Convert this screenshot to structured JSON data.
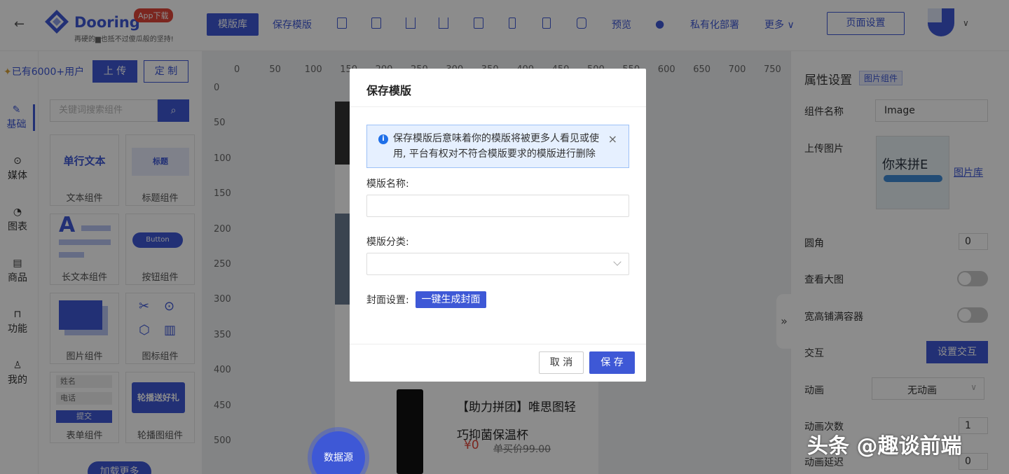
{
  "header": {
    "brand": "Dooring",
    "slogan": "再硬的▆也抵不过傻瓜般的坚持!",
    "app_badge": "App下载",
    "toolbar": {
      "template_lib": "模版库",
      "save_template": "保存模版",
      "preview": "预览",
      "private_deploy": "私有化部署",
      "more": "更多",
      "page_settings": "页面设置"
    }
  },
  "left_rail": {
    "items": [
      {
        "label": "基础",
        "icon": "brush-icon",
        "active": true
      },
      {
        "label": "媒体",
        "icon": "play-circle-icon"
      },
      {
        "label": "图表",
        "icon": "pie-chart-icon"
      },
      {
        "label": "商品",
        "icon": "shop-icon"
      },
      {
        "label": "功能",
        "icon": "function-icon"
      },
      {
        "label": "我的",
        "icon": "user-icon"
      }
    ]
  },
  "left_panel": {
    "users_text": "已有6000+用户",
    "upload": "上 传",
    "custom": "定 制",
    "search_placeholder": "关键词搜索组件",
    "components": [
      {
        "label": "文本组件",
        "preview": "单行文本"
      },
      {
        "label": "标题组件",
        "preview": "标题"
      },
      {
        "label": "长文本组件",
        "preview": "A"
      },
      {
        "label": "按钮组件",
        "preview": "Button"
      },
      {
        "label": "图片组件"
      },
      {
        "label": "图标组件"
      },
      {
        "label": "表单组件",
        "preview_name": "姓名",
        "preview_phone": "电话",
        "preview_submit": "提交"
      },
      {
        "label": "轮播图组件",
        "preview": "轮播送好礼"
      }
    ],
    "load_more": "加载更多"
  },
  "canvas": {
    "ruler_top": [
      "0",
      "50",
      "100",
      "150",
      "200",
      "250",
      "300",
      "350",
      "400",
      "450",
      "500",
      "550",
      "600",
      "650",
      "700",
      "750"
    ],
    "ruler_left": [
      "0",
      "50",
      "100",
      "150",
      "200",
      "250",
      "300",
      "350",
      "400",
      "450",
      "500"
    ],
    "product_title": "【助力拼团】唯思图轻巧抑菌保温杯",
    "product_price": "¥0",
    "product_old_price": "单买价99.00",
    "datasource": "数据源"
  },
  "right_panel": {
    "title": "属性设置",
    "tag": "图片组件",
    "name_label": "组件名称",
    "name_value": "Image",
    "upload_label": "上传图片",
    "image_text": "你来拼E",
    "image_lib": "图片库",
    "radius_label": "圆角",
    "radius_value": "0",
    "view_large_label": "查看大图",
    "fill_label": "宽高铺满容器",
    "interaction_label": "交互",
    "interaction_btn": "设置交互",
    "animation_label": "动画",
    "animation_value": "无动画",
    "anim_count_label": "动画次数",
    "anim_count_value": "1",
    "anim_delay_label": "动画延迟",
    "anim_delay_value": "0"
  },
  "modal": {
    "title": "保存模版",
    "alert": "保存模版后意味着你的模版将被更多人看见或使用, 平台有权对不符合模版要求的模版进行删除",
    "name_label": "模版名称:",
    "name_value": "",
    "category_label": "模版分类:",
    "category_value": "",
    "cover_label": "封面设置:",
    "generate_cover": "一键生成封面",
    "cancel": "取 消",
    "save": "保 存"
  },
  "watermark": "头条 @趣谈前端"
}
